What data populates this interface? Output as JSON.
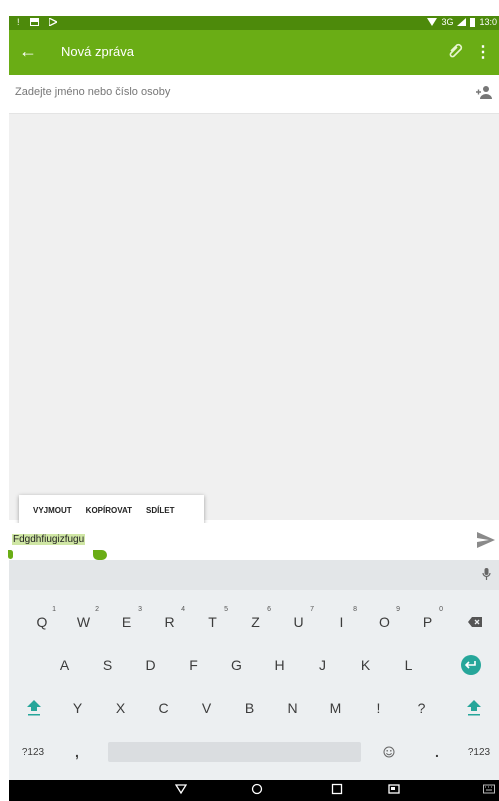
{
  "status_bar": {
    "network": "3G",
    "time": "13:0"
  },
  "app_bar": {
    "title": "Nová zpráva"
  },
  "recipient": {
    "placeholder": "Zadejte jméno nebo číslo osoby"
  },
  "context_menu": {
    "cut": "VYJMOUT",
    "copy": "KOPÍROVAT",
    "share": "SDÍLET"
  },
  "compose": {
    "text": "Fdgdhfiugizfugu"
  },
  "keyboard": {
    "row1": [
      {
        "key": "Q",
        "hint": "1"
      },
      {
        "key": "W",
        "hint": "2"
      },
      {
        "key": "E",
        "hint": "3"
      },
      {
        "key": "R",
        "hint": "4"
      },
      {
        "key": "T",
        "hint": "5"
      },
      {
        "key": "Z",
        "hint": "6"
      },
      {
        "key": "U",
        "hint": "7"
      },
      {
        "key": "I",
        "hint": "8"
      },
      {
        "key": "O",
        "hint": "9"
      },
      {
        "key": "P",
        "hint": "0"
      }
    ],
    "row2": [
      "A",
      "S",
      "D",
      "F",
      "G",
      "H",
      "J",
      "K",
      "L"
    ],
    "row3": [
      "Y",
      "X",
      "C",
      "V",
      "B",
      "N",
      "M",
      "!",
      "?"
    ],
    "row4": {
      "symbols_left": "?123",
      "comma": ",",
      "period": ".",
      "symbols_right": "?123"
    }
  },
  "colors": {
    "accent": "#6aad15",
    "status_bar": "#4d8a0b",
    "enter_key": "#26a69a",
    "shift_key": "#26a69a"
  },
  "icons": [
    "back-arrow-icon",
    "paperclip-icon",
    "overflow-menu-icon",
    "add-person-icon",
    "send-icon",
    "mic-icon",
    "backspace-icon",
    "enter-icon",
    "shift-icon",
    "emoji-icon",
    "nav-back-icon",
    "nav-home-icon",
    "nav-recents-icon",
    "keyboard-switch-icon"
  ]
}
